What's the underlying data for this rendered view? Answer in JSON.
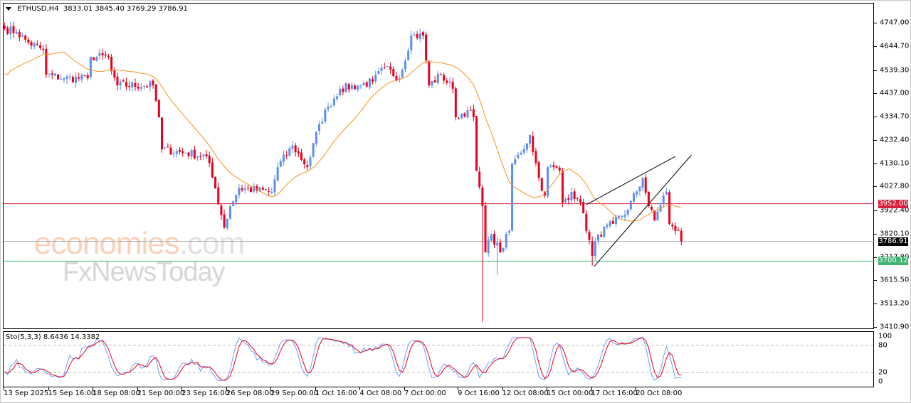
{
  "header": {
    "symbol": "ETHUSD,H4",
    "open": "3833.01",
    "high": "3845.40",
    "low": "3769.29",
    "close": "3786.91"
  },
  "watermark": {
    "brand1": "economies",
    "brand1_suffix": ".com",
    "brand2": "FxNewsToday"
  },
  "stochastic": {
    "label": "Sto(5,3,3)",
    "main": "8.6436",
    "signal": "14.3382",
    "levels": [
      "100",
      "80",
      "20",
      "0"
    ]
  },
  "colors": {
    "bull": "#5b8ff0",
    "bear": "#e8001c",
    "ma": "#f7931e",
    "resistance": "#d4213d",
    "current": "#000000",
    "support": "#3cb371",
    "stoch_main": "#6fa0f0",
    "stoch_signal": "#e8001c"
  },
  "price_axis": {
    "ticks": [
      "4747.00",
      "4644.70",
      "4539.30",
      "4437.00",
      "4334.70",
      "4232.40",
      "4130.10",
      "4027.80",
      "3922.40",
      "3820.10",
      "3717.80",
      "3615.50",
      "3513.20",
      "3410.90"
    ]
  },
  "levels": {
    "resistance": "3952.00",
    "current": "3786.91",
    "support": "3700.12"
  },
  "time_axis": [
    {
      "bar": 0,
      "label": "13 Sep 2025"
    },
    {
      "bar": 15,
      "label": "15 Sep 16:00"
    },
    {
      "bar": 30,
      "label": "18 Sep 08:00"
    },
    {
      "bar": 45,
      "label": "21 Sep 00:00"
    },
    {
      "bar": 60,
      "label": "23 Sep 16:00"
    },
    {
      "bar": 75,
      "label": "26 Sep 08:00"
    },
    {
      "bar": 90,
      "label": "29 Sep 00:00"
    },
    {
      "bar": 105,
      "label": "1 Oct 16:00"
    },
    {
      "bar": 120,
      "label": "4 Oct 08:00"
    },
    {
      "bar": 135,
      "label": "7 Oct 00:00"
    },
    {
      "bar": 153,
      "label": "9 Oct 16:00"
    },
    {
      "bar": 168,
      "label": "12 Oct 08:00"
    },
    {
      "bar": 183,
      "label": "15 Oct 00:00"
    },
    {
      "bar": 198,
      "label": "17 Oct 16:00"
    },
    {
      "bar": 213,
      "label": "20 Oct 08:00"
    }
  ],
  "chart_data": {
    "type": "candlestick",
    "title": "ETHUSD,H4",
    "ylim": [
      3410.9,
      4747.0
    ],
    "close_path": [
      [
        0,
        4722
      ],
      [
        4,
        4706
      ],
      [
        8,
        4660
      ],
      [
        13,
        4628
      ],
      [
        14,
        4519
      ],
      [
        20,
        4503
      ],
      [
        28,
        4503
      ],
      [
        29,
        4597
      ],
      [
        35,
        4597
      ],
      [
        36,
        4535
      ],
      [
        38,
        4472
      ],
      [
        50,
        4472
      ],
      [
        52,
        4332
      ],
      [
        53,
        4191
      ],
      [
        61,
        4176
      ],
      [
        68,
        4160
      ],
      [
        71,
        4020
      ],
      [
        74,
        3848
      ],
      [
        76,
        3942
      ],
      [
        79,
        4020
      ],
      [
        90,
        4004
      ],
      [
        92,
        4113
      ],
      [
        97,
        4207
      ],
      [
        102,
        4113
      ],
      [
        106,
        4301
      ],
      [
        109,
        4379
      ],
      [
        113,
        4457
      ],
      [
        119,
        4472
      ],
      [
        124,
        4488
      ],
      [
        128,
        4550
      ],
      [
        133,
        4503
      ],
      [
        137,
        4691
      ],
      [
        141,
        4691
      ],
      [
        143,
        4472
      ],
      [
        147,
        4519
      ],
      [
        151,
        4457
      ],
      [
        152,
        4332
      ],
      [
        156,
        4363
      ],
      [
        158,
        4332
      ],
      [
        159,
        4098
      ],
      [
        161,
        3942
      ],
      [
        162,
        3739
      ],
      [
        164,
        3817
      ],
      [
        167,
        3739
      ],
      [
        170,
        3832
      ],
      [
        171,
        4129
      ],
      [
        174,
        4176
      ],
      [
        177,
        4254
      ],
      [
        180,
        4066
      ],
      [
        182,
        3988
      ],
      [
        183,
        4113
      ],
      [
        187,
        4098
      ],
      [
        188,
        3957
      ],
      [
        191,
        4004
      ],
      [
        193,
        3973
      ],
      [
        195,
        3910
      ],
      [
        198,
        3723
      ],
      [
        200,
        3817
      ],
      [
        205,
        3864
      ],
      [
        210,
        3926
      ],
      [
        215,
        4066
      ],
      [
        217,
        3942
      ],
      [
        219,
        3879
      ],
      [
        222,
        3988
      ],
      [
        223,
        4004
      ],
      [
        224,
        3864
      ],
      [
        226,
        3833.01
      ],
      [
        227,
        3833.01
      ],
      [
        228,
        3786.91
      ]
    ],
    "low_overrides": [
      [
        161,
        3433
      ],
      [
        166,
        3640
      ],
      [
        198,
        3680
      ]
    ],
    "moving_average_period": 20,
    "trendlines": [
      {
        "name": "wedge-lower",
        "from": [
          198.6,
          3676
        ],
        "to": [
          231.4,
          4166
        ]
      },
      {
        "name": "wedge-upper",
        "from": [
          196,
          3948
        ],
        "to": [
          226,
          4160
        ]
      }
    ],
    "horizontal_levels": [
      3952.0,
      3786.91,
      3700.12
    ]
  }
}
